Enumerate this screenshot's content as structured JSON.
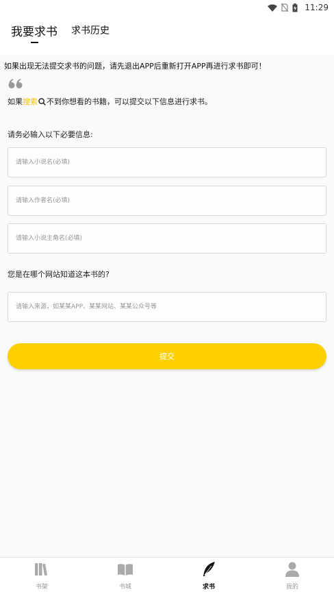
{
  "status_bar": {
    "time": "11:29"
  },
  "header": {
    "tabs": [
      {
        "label": "我要求书",
        "active": true
      },
      {
        "label": "求书历史",
        "active": false
      }
    ]
  },
  "notice": "如果出现无法提交求书的问题，请先退出APP后重新打开APP再进行求书即可！",
  "tip": {
    "prefix": "如果",
    "highlight": "搜索",
    "suffix": "不到你想看的书籍，可以提交以下信息进行求书。"
  },
  "required_label": "请务必输入以下必要信息:",
  "fields": {
    "novel_name_placeholder": "请输入小说名(必填)",
    "author_placeholder": "请输入作者名(必填)",
    "protagonist_placeholder": "请输入小说主角名(必填)",
    "source_placeholder": "请输入来源，如某某APP、某某网站、某某公众号等"
  },
  "source_question": "您是在哪个网站知道这本书的?",
  "submit_label": "提交",
  "bottom_nav": [
    {
      "label": "书架",
      "icon": "bookshelf-icon",
      "active": false
    },
    {
      "label": "书城",
      "icon": "open-book-icon",
      "active": false
    },
    {
      "label": "求书",
      "icon": "feather-icon",
      "active": true
    },
    {
      "label": "我的",
      "icon": "user-icon",
      "active": false
    }
  ],
  "colors": {
    "accent": "#ffd000",
    "highlight_text": "#f5c400",
    "inactive_nav": "#999999"
  }
}
